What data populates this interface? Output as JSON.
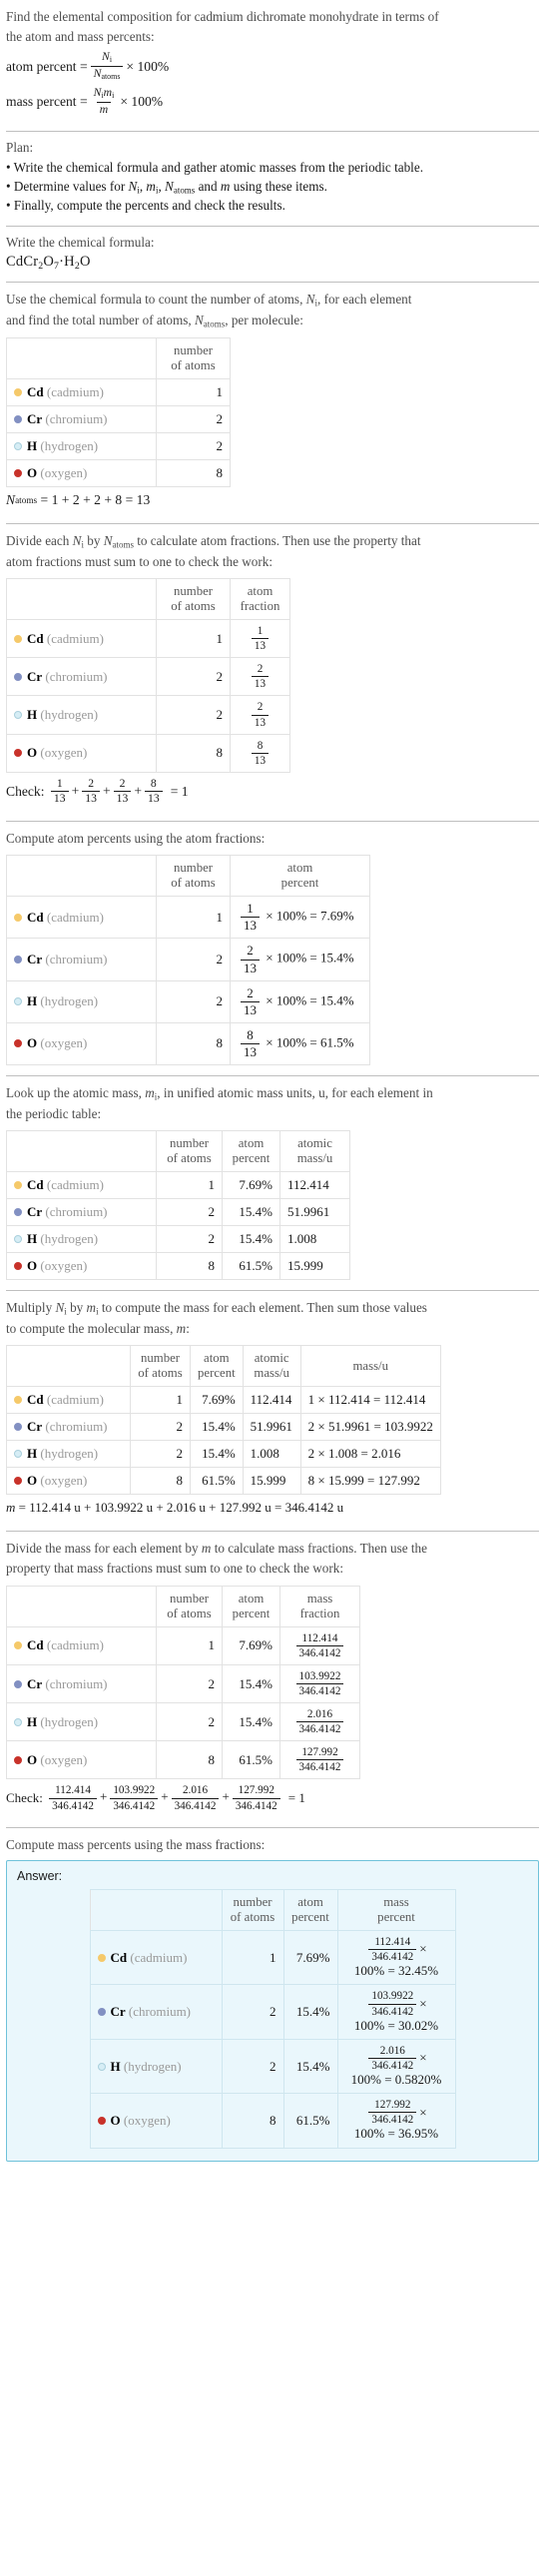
{
  "problem": {
    "statement_line1": "Find the elemental composition for cadmium dichromate monohydrate in terms of",
    "statement_line2": "the atom and mass percents:",
    "atom_percent_label": "atom percent =",
    "mass_percent_label": "mass percent =",
    "times_100": "× 100%",
    "N_i": "N",
    "N_i_sub": "i",
    "N_atoms": "N",
    "N_atoms_sub": "atoms",
    "m_i": "m",
    "m_i_sub": "i",
    "m": "m"
  },
  "plan": {
    "heading": "Plan:",
    "bullets": [
      "• Write the chemical formula and gather atomic masses from the periodic table.",
      "• Determine values for Nᵢ, mᵢ, Nₐₜₒₘₛ and m using these items.",
      "• Finally, compute the percents and check the results."
    ],
    "bullet2_parts": {
      "pre": "• Determine values for ",
      "mid": " and ",
      "post": " using these items."
    }
  },
  "formula_section": {
    "prompt": "Write the chemical formula:",
    "formula_parts": [
      "CdCr",
      "2",
      "O",
      "7",
      "·H",
      "2",
      "O"
    ],
    "formula_plain": "CdCr2O7·H2O"
  },
  "count_section": {
    "prompt_line1": "Use the chemical formula to count the number of atoms, Nᵢ, for each element",
    "prompt_line2": "and find the total number of atoms, Nₐₜₒₘₛ, per molecule:",
    "headers": [
      "",
      "number of atoms"
    ],
    "total_line": "Nₐₜₒₘₛ = 1 + 2 + 2 + 8 = 13",
    "total_expression": "1 + 2 + 2 + 8 = 13"
  },
  "fraction_section": {
    "prompt_line1": "Divide each Nᵢ by Nₐₜₒₘₛ to calculate atom fractions. Then use the property that",
    "prompt_line2": "atom fractions must sum to one to check the work:",
    "headers": [
      "",
      "number of atoms",
      "atom fraction"
    ],
    "check_label": "Check:",
    "check_result": "= 1"
  },
  "atom_percent_section": {
    "prompt": "Compute atom percents using the atom fractions:",
    "headers": [
      "",
      "number of atoms",
      "atom percent"
    ]
  },
  "atomic_mass_section": {
    "prompt_line1": "Look up the atomic mass, mᵢ, in unified atomic mass units, u, for each element in",
    "prompt_line2": "the periodic table:",
    "headers": [
      "",
      "number of atoms",
      "atom percent",
      "atomic mass/u"
    ]
  },
  "mass_section": {
    "prompt_line1": "Multiply Nᵢ by mᵢ to compute the mass for each element. Then sum those values",
    "prompt_line2": "to compute the molecular mass, m:",
    "headers": [
      "",
      "number of atoms",
      "atom percent",
      "atomic mass/u",
      "mass/u"
    ],
    "molecular_mass_line": "m = 112.414 u + 103.9922 u + 2.016 u + 127.992 u = 346.4142 u",
    "molecular_mass_expression": "112.414 u + 103.9922 u + 2.016 u + 127.992 u = 346.4142 u"
  },
  "mass_fraction_section": {
    "prompt_line1": "Divide the mass for each element by m to calculate mass fractions. Then use the",
    "prompt_line2": "property that mass fractions must sum to one to check the work:",
    "headers": [
      "",
      "number of atoms",
      "atom percent",
      "mass fraction"
    ],
    "check_label": "Check:",
    "check_result": "= 1"
  },
  "mass_percent_section": {
    "prompt": "Compute mass percents using the mass fractions:",
    "answer_label": "Answer:",
    "headers": [
      "",
      "number of atoms",
      "atom percent",
      "mass percent"
    ]
  },
  "molecular_mass_total": "346.4142",
  "total_atoms": "13",
  "elements": [
    {
      "symbol": "Cd",
      "name": "(cadmium)",
      "color": "#f5c96a",
      "filled": true,
      "count": "1",
      "atom_fraction_num": "1",
      "atom_fraction_den": "13",
      "atom_percent": "7.69%",
      "atomic_mass": "112.414",
      "mass_expression": "1 × 112.414 = 112.414",
      "mass": "112.414",
      "mass_percent": "32.45%"
    },
    {
      "symbol": "Cr",
      "name": "(chromium)",
      "color": "#8290c2",
      "filled": true,
      "count": "2",
      "atom_fraction_num": "2",
      "atom_fraction_den": "13",
      "atom_percent": "15.4%",
      "atomic_mass": "51.9961",
      "mass_expression": "2 × 51.9961 = 103.9922",
      "mass": "103.9922",
      "mass_percent": "30.02%"
    },
    {
      "symbol": "H",
      "name": "(hydrogen)",
      "color": "#d6edf5",
      "filled": false,
      "count": "2",
      "atom_fraction_num": "2",
      "atom_fraction_den": "13",
      "atom_percent": "15.4%",
      "atomic_mass": "1.008",
      "mass_expression": "2 × 1.008 = 2.016",
      "mass": "2.016",
      "mass_percent": "0.5820%"
    },
    {
      "symbol": "O",
      "name": "(oxygen)",
      "color": "#c8322a",
      "filled": true,
      "count": "8",
      "atom_fraction_num": "8",
      "atom_fraction_den": "13",
      "atom_percent": "61.5%",
      "atomic_mass": "15.999",
      "mass_expression": "8 × 15.999 = 127.992",
      "mass": "127.992",
      "mass_percent": "36.95%"
    }
  ],
  "common": {
    "times_100_percent": "× 100%",
    "equals": "=",
    "plus": "+",
    "percent_100": "100%"
  }
}
